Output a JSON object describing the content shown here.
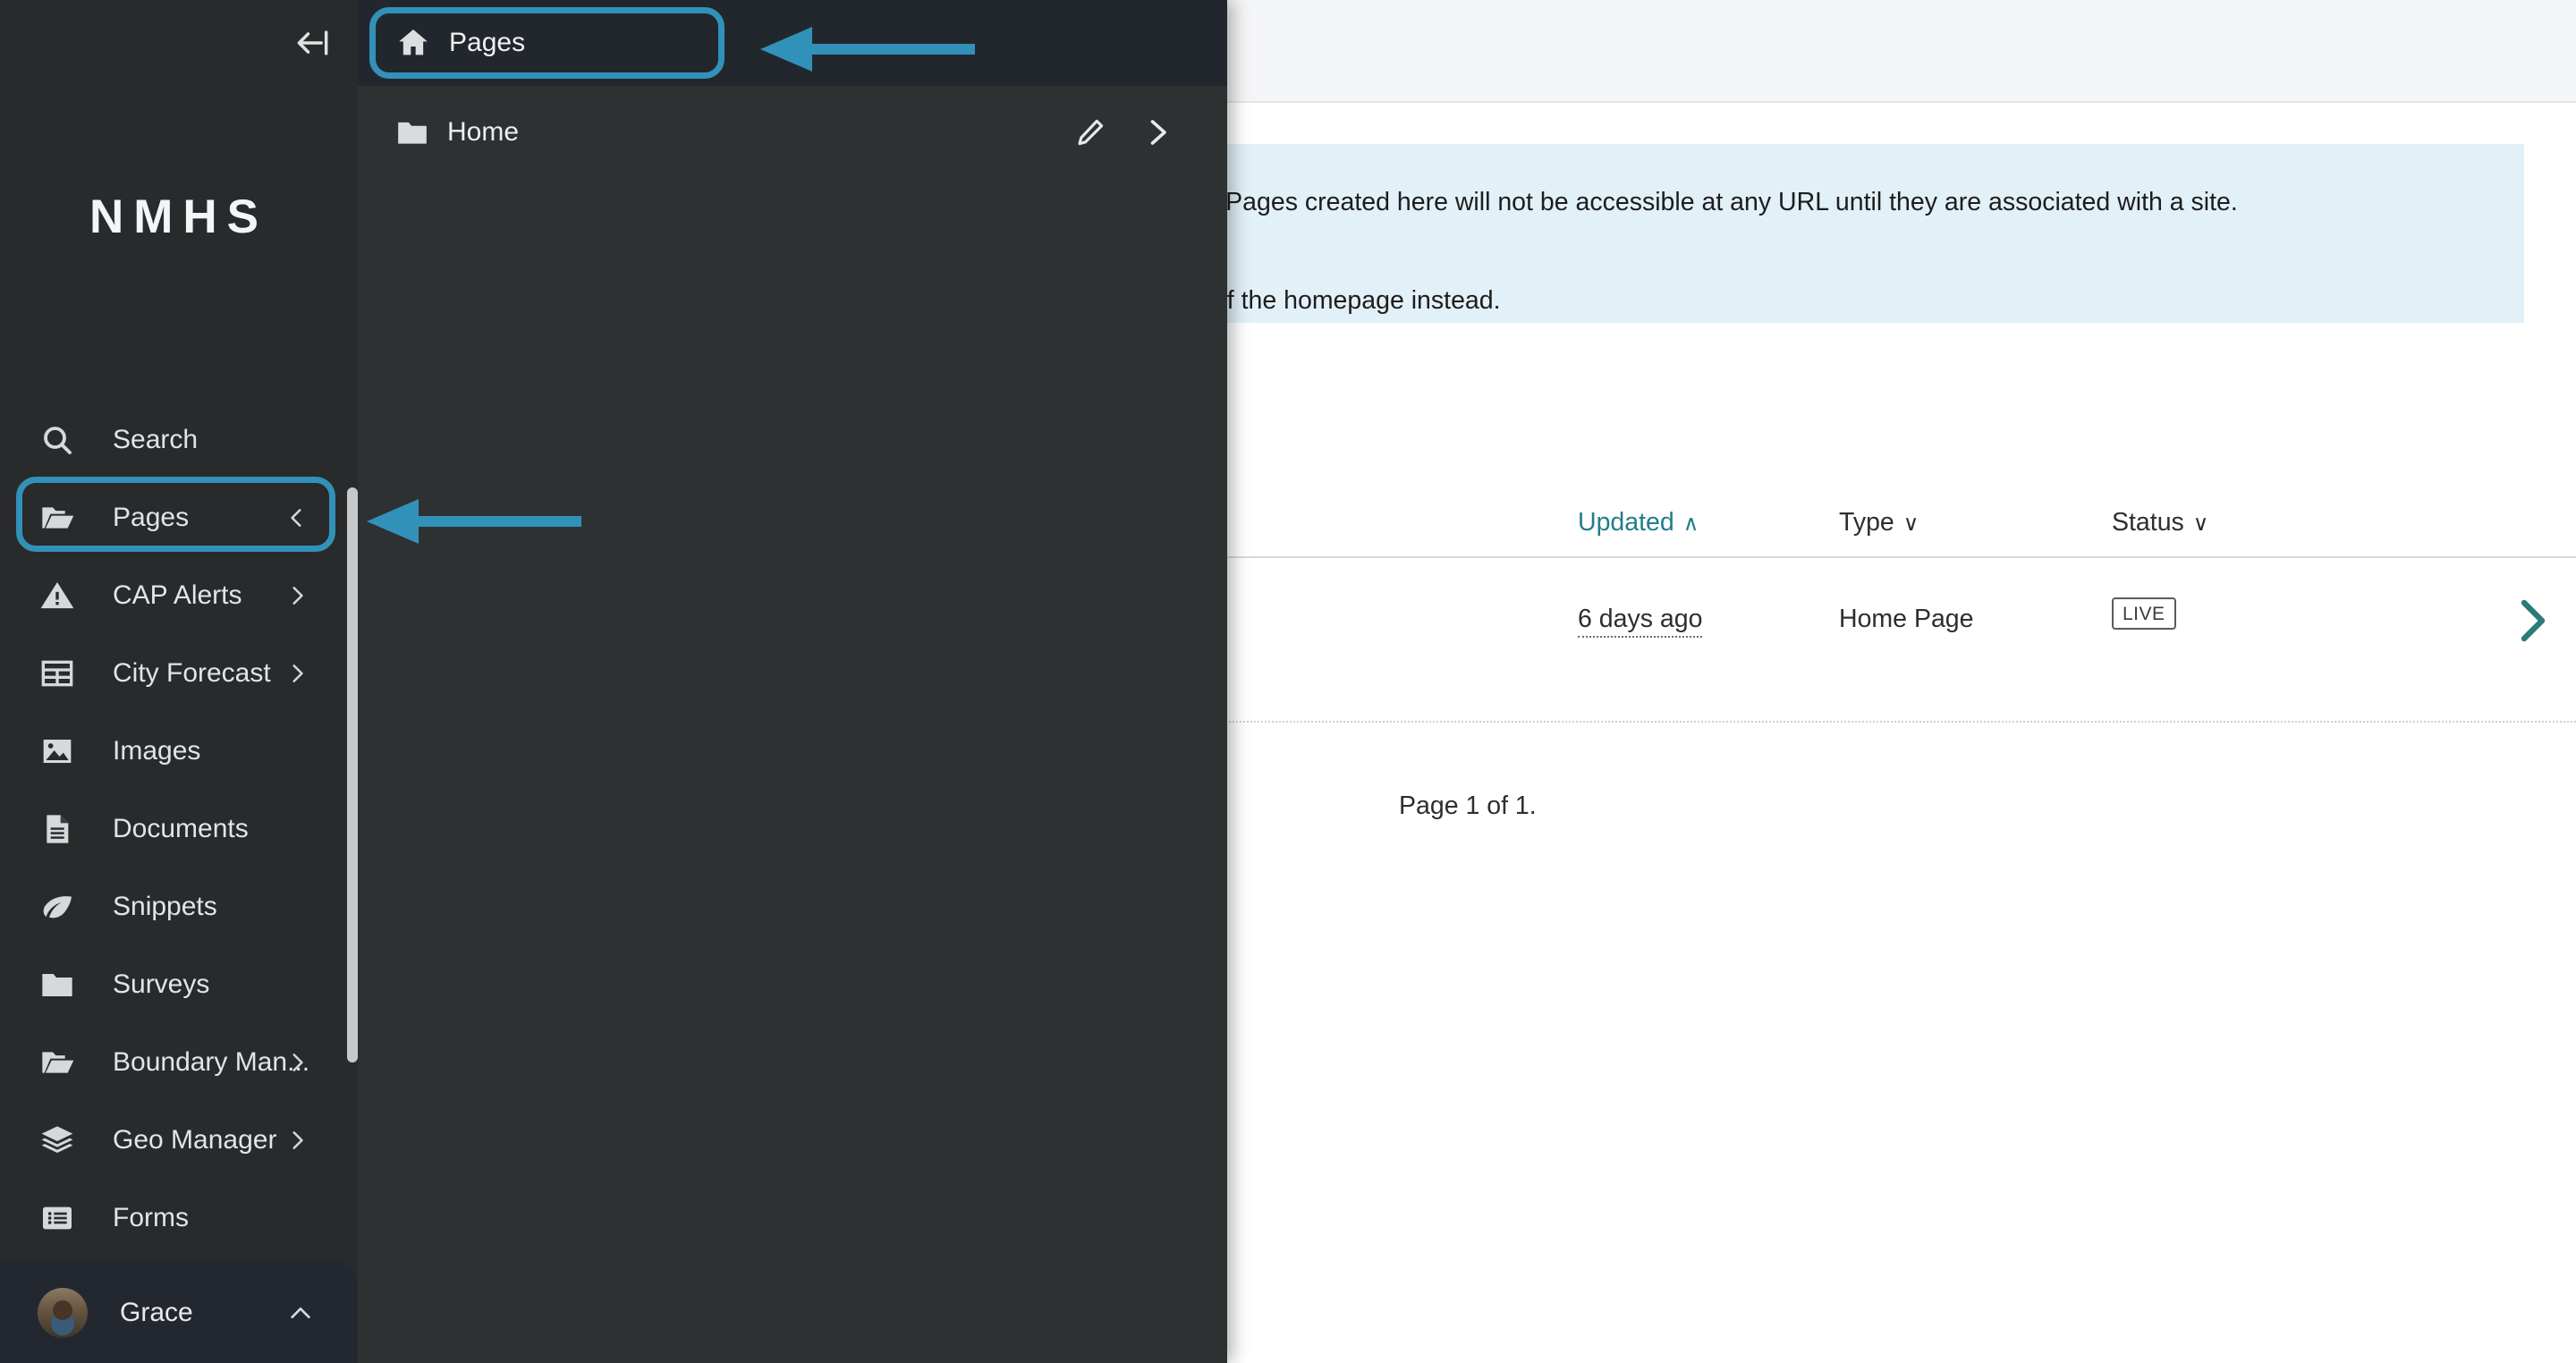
{
  "app": {
    "brand": "NMHS"
  },
  "sidebar": {
    "collapse_icon": "collapse-left-icon",
    "items": [
      {
        "label": "Search",
        "icon": "search-icon",
        "arrow": ""
      },
      {
        "label": "Pages",
        "icon": "folder-open-icon",
        "arrow": "‹"
      },
      {
        "label": "CAP Alerts",
        "icon": "warning-icon",
        "arrow": "›"
      },
      {
        "label": "City Forecast",
        "icon": "table-icon",
        "arrow": "›"
      },
      {
        "label": "Images",
        "icon": "image-icon",
        "arrow": ""
      },
      {
        "label": "Documents",
        "icon": "document-icon",
        "arrow": ""
      },
      {
        "label": "Snippets",
        "icon": "leaf-icon",
        "arrow": ""
      },
      {
        "label": "Surveys",
        "icon": "folder-icon",
        "arrow": ""
      },
      {
        "label": "Boundary Man...",
        "icon": "folder-open-icon",
        "arrow": "›"
      },
      {
        "label": "Geo Manager",
        "icon": "layers-icon",
        "arrow": "›"
      },
      {
        "label": "Forms",
        "icon": "forms-icon",
        "arrow": ""
      }
    ],
    "user": {
      "name": "Grace",
      "caret": "chevron-up-icon"
    }
  },
  "submenu": {
    "title": "Pages",
    "title_icon": "home-icon",
    "rows": [
      {
        "label": "Home",
        "icon": "folder-icon",
        "edit_icon": "pencil-icon",
        "chevron_icon": "chevron-right-icon"
      }
    ]
  },
  "main": {
    "info_banner": {
      "line1": "nstallation. Pages created here will not be accessible at any URL until they are associated with a site.",
      "line2": "s children of the homepage instead."
    },
    "table": {
      "columns": [
        {
          "label": "Updated",
          "caret": "∧",
          "sorted": true
        },
        {
          "label": "Type",
          "caret": "∨",
          "sorted": false
        },
        {
          "label": "Status",
          "caret": "∨",
          "sorted": false
        }
      ],
      "rows": [
        {
          "updated": "6 days ago",
          "type": "Home Page",
          "status": "LIVE",
          "chevron": "chevron-right-icon"
        }
      ]
    },
    "page_count": "Page 1 of 1."
  },
  "annotations": {
    "accent_color": "#3291b8",
    "arrows": [
      {
        "name": "arrow-to-submenu-pages-header"
      },
      {
        "name": "arrow-to-sidebar-pages-item"
      }
    ],
    "highlights": [
      {
        "name": "highlight-submenu-pages-header"
      },
      {
        "name": "highlight-sidebar-pages-item"
      }
    ]
  }
}
